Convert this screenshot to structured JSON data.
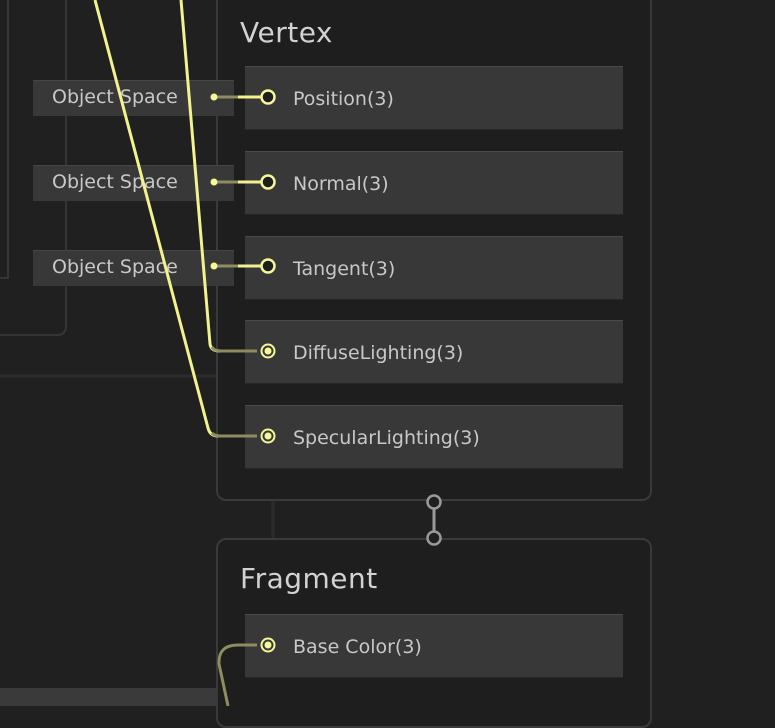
{
  "contexts": {
    "vertex": {
      "title": "Vertex",
      "blocks": [
        {
          "label": "Position(3)",
          "space": "Object Space",
          "connected_source": "local"
        },
        {
          "label": "Normal(3)",
          "space": "Object Space",
          "connected_source": "local"
        },
        {
          "label": "Tangent(3)",
          "space": "Object Space",
          "connected_source": "local"
        },
        {
          "label": "DiffuseLighting(3)",
          "connected_source": "external"
        },
        {
          "label": "SpecularLighting(3)",
          "connected_source": "external"
        }
      ]
    },
    "fragment": {
      "title": "Fragment",
      "blocks": [
        {
          "label": "Base Color(3)",
          "connected_source": "external"
        }
      ]
    }
  },
  "colors": {
    "background": "#202020",
    "context_border": "#3a3a3a",
    "block_fill": "#383838",
    "wire_bright": "#f2f28e",
    "wire_dim": "#8d8d5f",
    "port_fill": "#f7f79a",
    "flow_port": "#8a8a8a"
  },
  "icons": {
    "input_port": "ring-port-icon",
    "connected_port": "filled-port-icon",
    "flow_connector": "flow-port-icon"
  }
}
